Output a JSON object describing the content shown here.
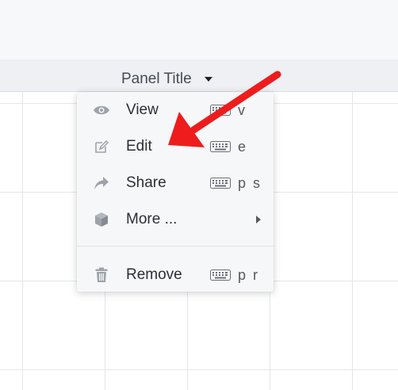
{
  "panel": {
    "title": "Panel Title"
  },
  "menu": {
    "items": [
      {
        "label": "View",
        "icon": "eye-icon",
        "shortcut": "v"
      },
      {
        "label": "Edit",
        "icon": "edit-icon",
        "shortcut": "e"
      },
      {
        "label": "Share",
        "icon": "share-icon",
        "shortcut": "p s"
      },
      {
        "label": "More ...",
        "icon": "cube-icon",
        "shortcut": ""
      },
      {
        "label": "Remove",
        "icon": "trash-icon",
        "shortcut": "p r"
      }
    ]
  },
  "colors": {
    "annotation_arrow": "#ee1c1c",
    "menu_background": "#f6f7f9",
    "header_background": "#eef0f3"
  }
}
